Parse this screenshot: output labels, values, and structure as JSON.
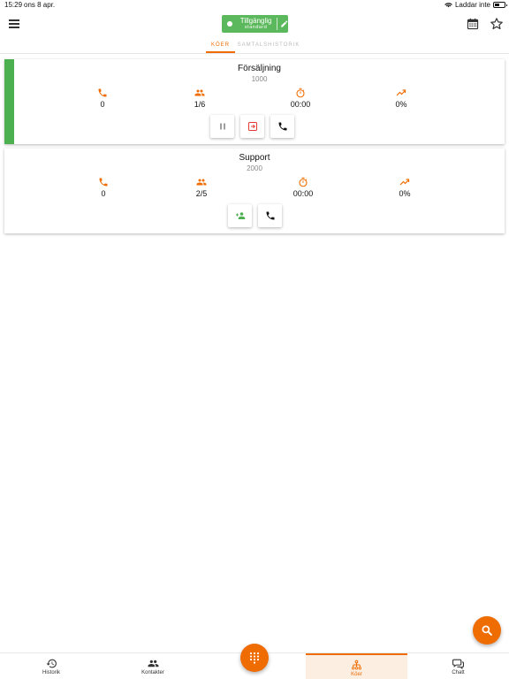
{
  "statusbar": {
    "time": "15:29",
    "date": "ons 8 apr.",
    "charging": "Laddar inte"
  },
  "header": {
    "status_label": "Tillgänglig",
    "status_sub": "standard"
  },
  "tabs": [
    {
      "label": "KÖER",
      "active": true
    },
    {
      "label": "SAMTALSHISTORIK",
      "active": false
    }
  ],
  "queues": [
    {
      "name": "Försäljning",
      "number": "1000",
      "calls": "0",
      "agents": "1/6",
      "wait": "00:00",
      "rate": "0%"
    },
    {
      "name": "Support",
      "number": "2000",
      "calls": "0",
      "agents": "2/5",
      "wait": "00:00",
      "rate": "0%"
    }
  ],
  "nav": [
    {
      "label": "Historik",
      "icon": "history-icon"
    },
    {
      "label": "Kontakter",
      "icon": "contacts-icon"
    },
    {
      "label": "Köer",
      "icon": "queues-icon",
      "active": true
    },
    {
      "label": "Chatt",
      "icon": "chat-icon"
    }
  ],
  "colors": {
    "accent": "#ef6c00",
    "available": "#5cb85c",
    "logged_in": "#4caf50",
    "danger": "#e53935"
  }
}
